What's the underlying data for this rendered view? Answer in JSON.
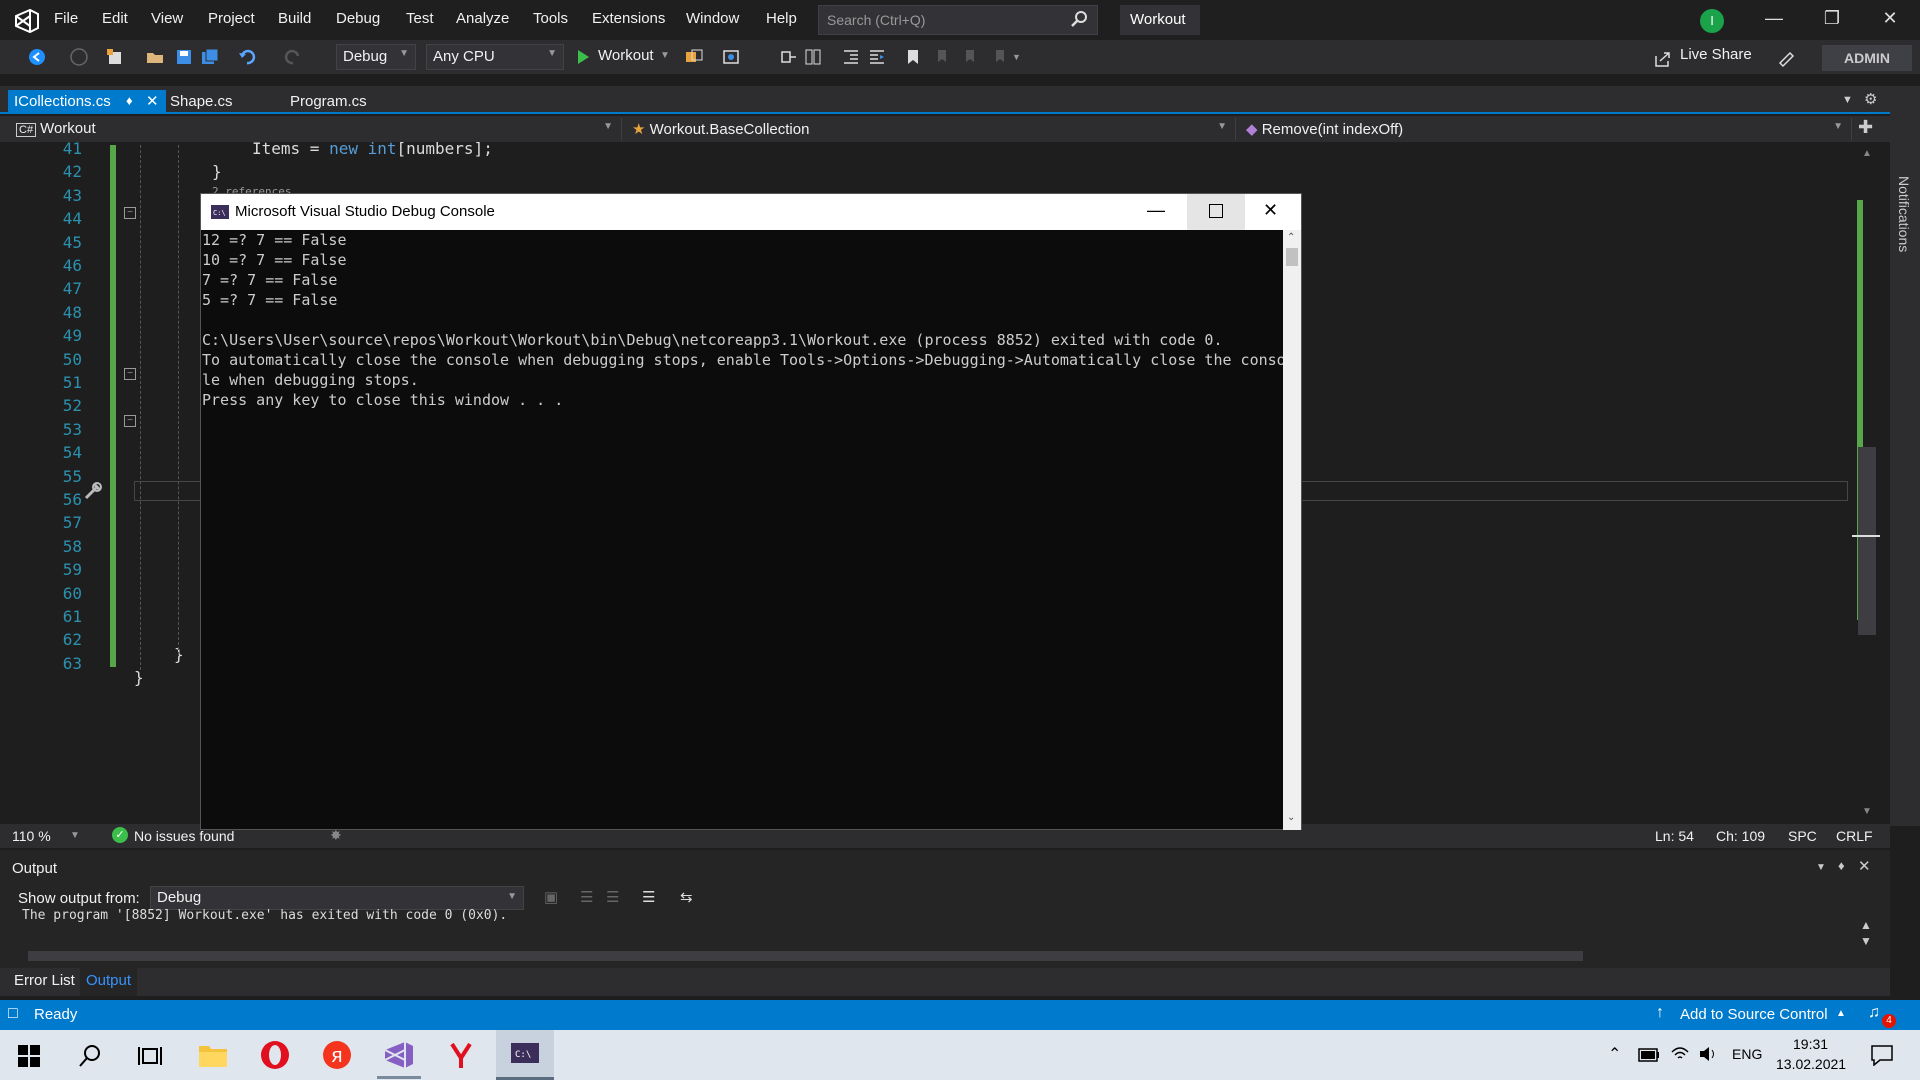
{
  "menubar": {
    "items": [
      "File",
      "Edit",
      "View",
      "Project",
      "Build",
      "Debug",
      "Test",
      "Analyze",
      "Tools",
      "Extensions",
      "Window",
      "Help"
    ],
    "search_placeholder": "Search (Ctrl+Q)",
    "solution_title": "Workout",
    "avatar_initial": "I"
  },
  "toolbar": {
    "config": "Debug",
    "platform": "Any CPU",
    "start_label": "Workout",
    "live_share": "Live Share",
    "admin": "ADMIN"
  },
  "tabs": [
    {
      "label": "ICollections.cs",
      "active": true
    },
    {
      "label": "Shape.cs",
      "active": false
    },
    {
      "label": "Program.cs",
      "active": false
    }
  ],
  "navbar": {
    "project": "Workout",
    "type": "Workout.BaseCollection",
    "member": "Remove(int indexOff)"
  },
  "side_label": "Notifications",
  "editor": {
    "line_numbers": [
      "41",
      "42",
      "43",
      "44",
      "45",
      "46",
      "47",
      "48",
      "49",
      "50",
      "51",
      "52",
      "53",
      "54",
      "55",
      "56",
      "57",
      "58",
      "59",
      "60",
      "61",
      "62",
      "63"
    ],
    "code_41": "Items = new int[numbers];",
    "code_42": "}",
    "code_ref": "2 references",
    "code_61": "}",
    "code_62": "}"
  },
  "console": {
    "title": "Microsoft Visual Studio Debug Console",
    "lines": [
      "12 =? 7 == False",
      "10 =? 7 == False",
      "7 =? 7 == False",
      "5 =? 7 == False",
      "",
      "C:\\Users\\User\\source\\repos\\Workout\\Workout\\bin\\Debug\\netcoreapp3.1\\Workout.exe (process 8852) exited with code 0.",
      "To automatically close the console when debugging stops, enable Tools->Options->Debugging->Automatically close the conso",
      "le when debugging stops.",
      "Press any key to close this window . . ."
    ]
  },
  "statusline": {
    "zoom": "110 %",
    "issues": "No issues found",
    "ln": "Ln: 54",
    "ch": "Ch: 109",
    "spc": "SPC",
    "crlf": "CRLF"
  },
  "output": {
    "title": "Output",
    "show_from_label": "Show output from:",
    "source": "Debug",
    "text": "The program '[8852] Workout.exe' has exited with code 0 (0x0)."
  },
  "bottom_tabs": [
    "Error List",
    "Output"
  ],
  "statusbar": {
    "ready": "Ready",
    "source_control": "Add to Source Control",
    "notif_count": "4"
  },
  "taskbar": {
    "lang": "ENG",
    "time": "19:31",
    "date": "13.02.2021"
  },
  "colors": {
    "accent": "#007acc",
    "taskbar": "#dfe6ee"
  }
}
